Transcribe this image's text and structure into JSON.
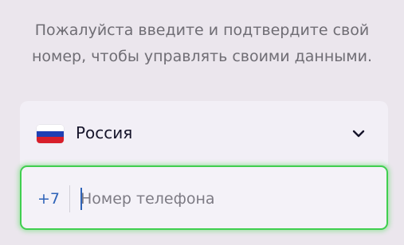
{
  "instructions": {
    "line1": "Пожалуйста введите и подтвердите свой",
    "line2": "номер, чтобы управлять своими данными."
  },
  "country_select": {
    "flag_icon": "russia-flag-icon",
    "country_name": "Россия",
    "chevron_icon": "chevron-down-icon"
  },
  "phone_field": {
    "country_code": "+7",
    "placeholder": "Номер телефона",
    "value": ""
  },
  "colors": {
    "background": "#ebe6ed",
    "focus_border": "#3fcf4f",
    "code_color": "#2e63b8"
  }
}
